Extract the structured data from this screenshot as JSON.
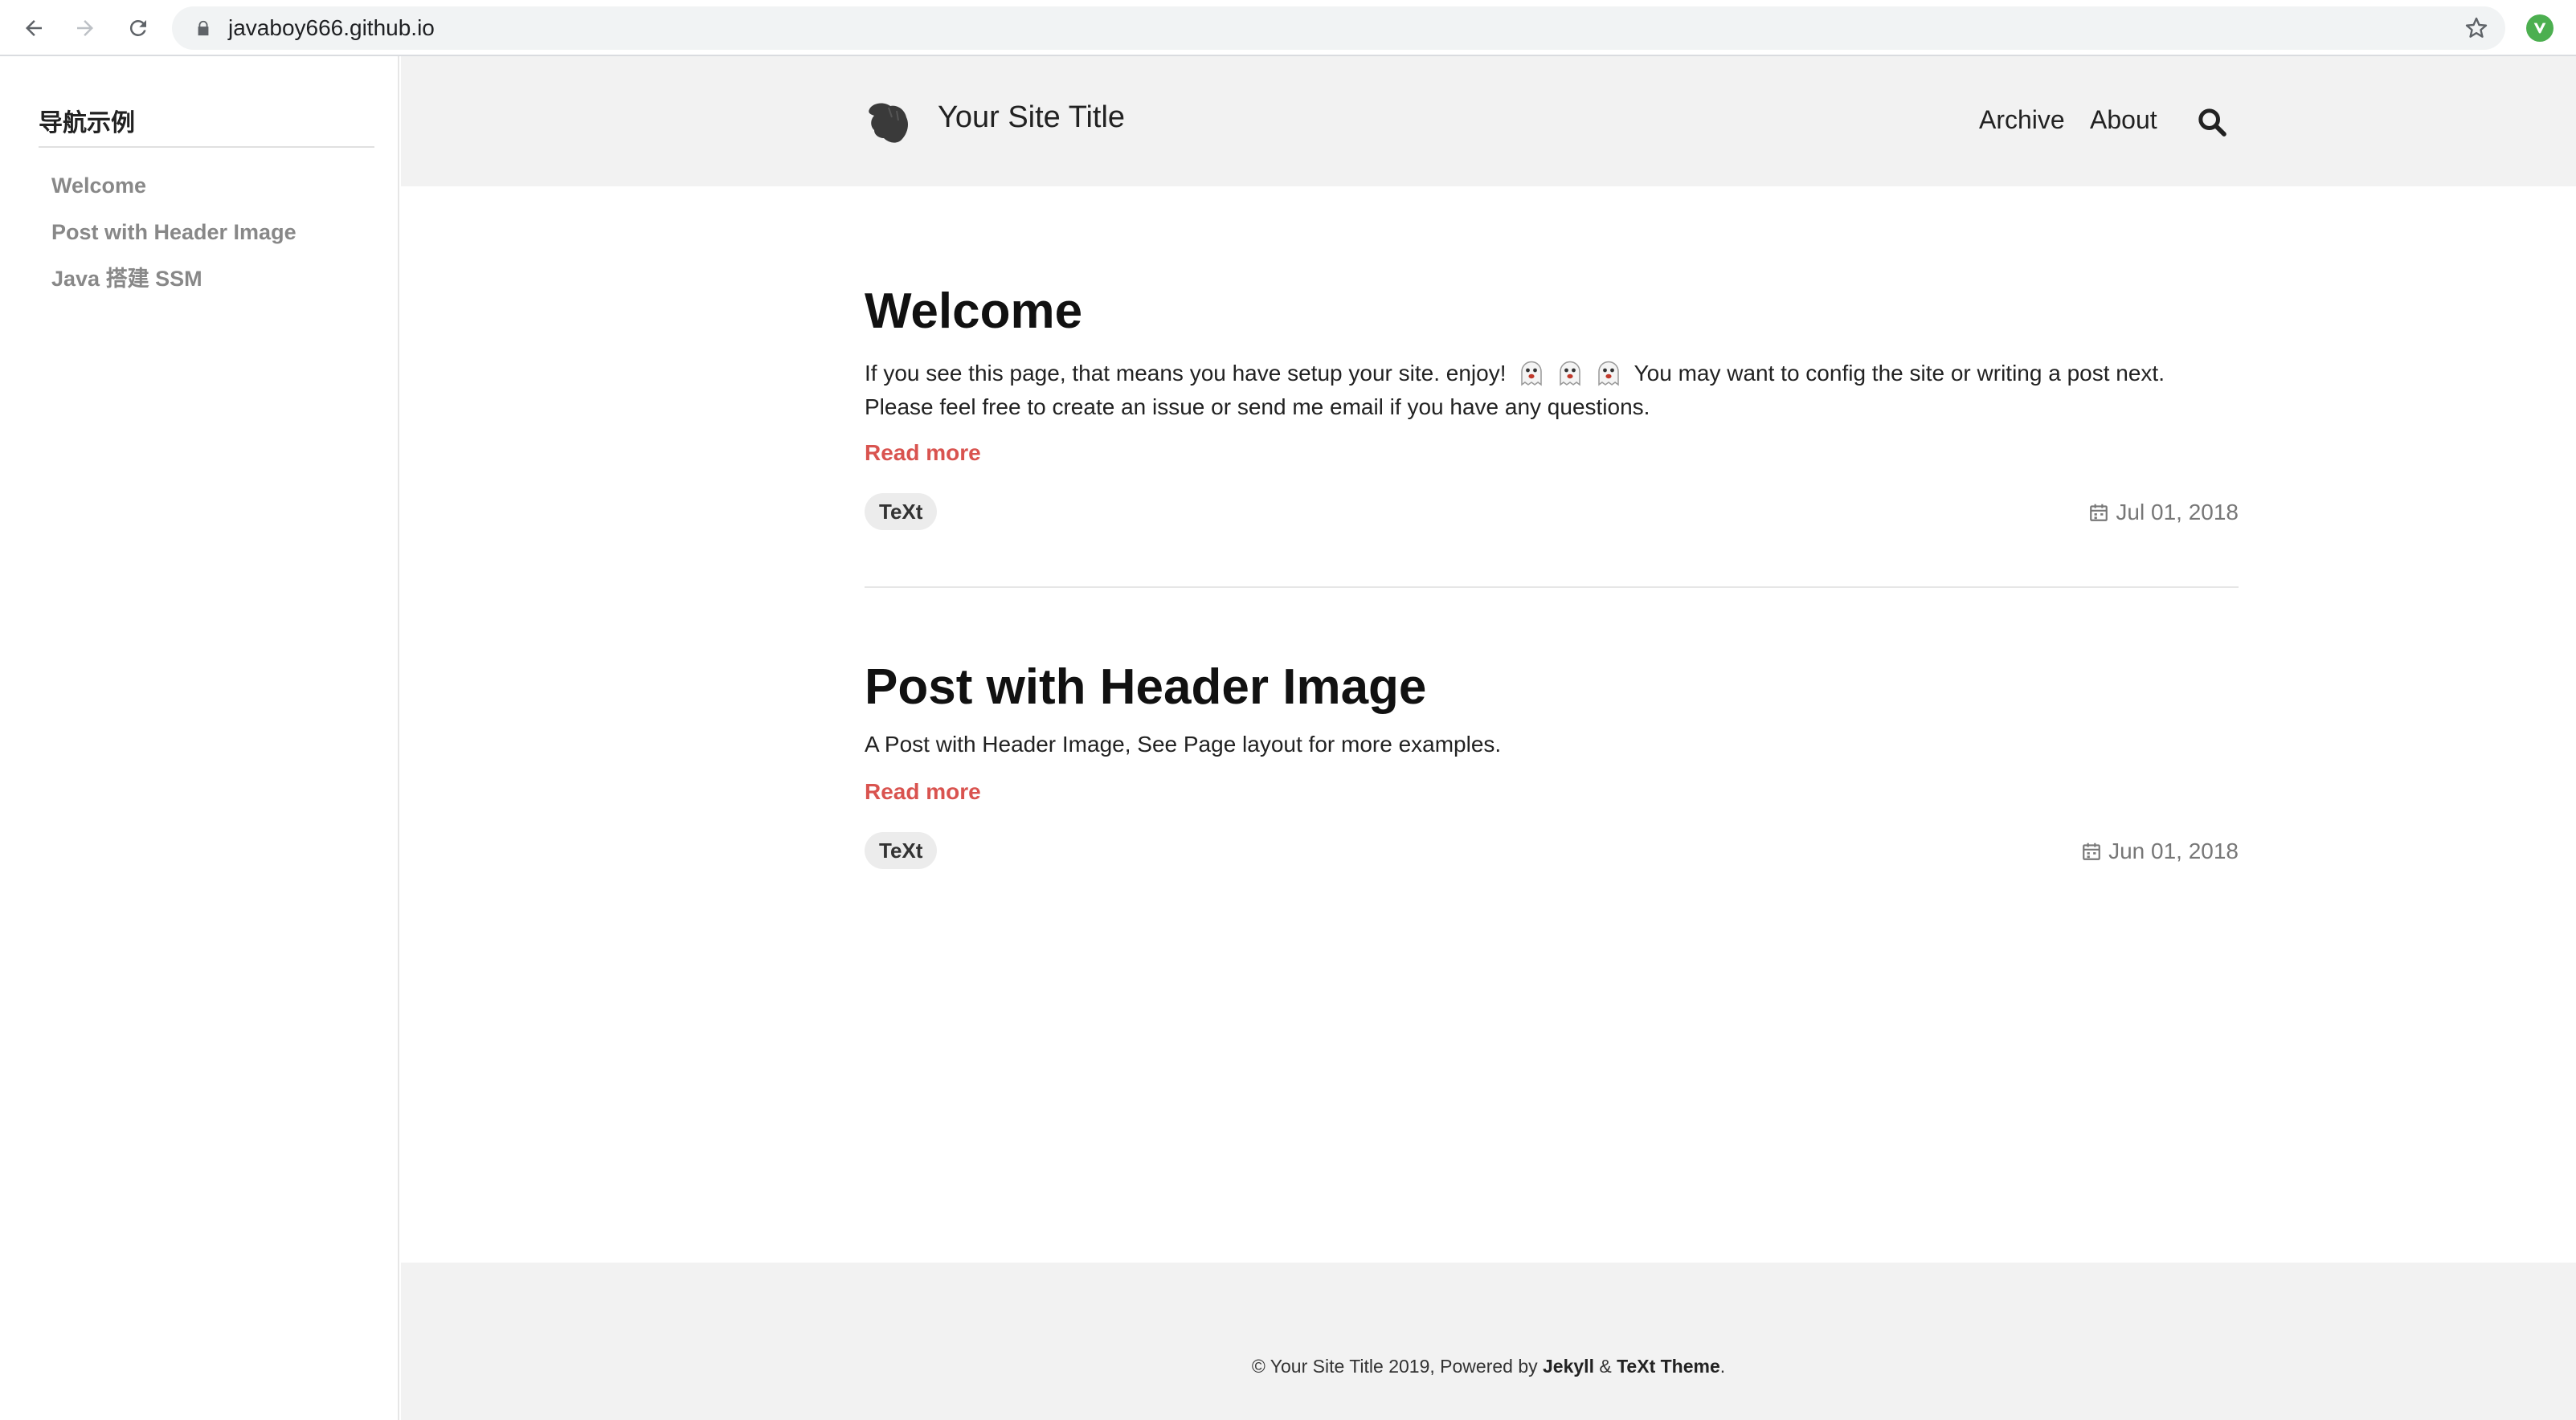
{
  "browser": {
    "url": "javaboy666.github.io"
  },
  "sidebar": {
    "title": "导航示例",
    "items": [
      {
        "label": "Welcome"
      },
      {
        "label": "Post with Header Image"
      },
      {
        "label": "Java 搭建 SSM"
      }
    ]
  },
  "header": {
    "site_title": "Your Site Title",
    "nav": [
      {
        "label": "Archive"
      },
      {
        "label": "About"
      }
    ]
  },
  "posts": [
    {
      "title": "Welcome",
      "excerpt_line1_a": "If you see this page, that means you have setup your site. enjoy!",
      "excerpt_line1_b": "You may want to config the site or writing a post next.",
      "excerpt_line2": "Please feel free to create an issue or send me email if you have any questions.",
      "read_more": "Read more",
      "tag": "TeXt",
      "date": "Jul 01, 2018"
    },
    {
      "title": "Post with Header Image",
      "excerpt_line1_a": "A Post with Header Image, See Page layout for more examples.",
      "read_more": "Read more",
      "tag": "TeXt",
      "date": "Jun 01, 2018"
    }
  ],
  "footer": {
    "prefix": "© Your Site Title 2019, Powered by",
    "jekyll": "Jekyll",
    "amp": "&",
    "theme": "TeXt Theme",
    "suffix": "."
  },
  "colors": {
    "accent": "#d9534f",
    "header_bg": "#f2f2f2"
  },
  "icons": [
    "back-arrow-icon",
    "forward-arrow-icon",
    "reload-icon",
    "lock-icon",
    "star-icon",
    "extension-icon",
    "logo-icon",
    "search-icon",
    "calendar-icon",
    "ghost-emoji-icon"
  ]
}
